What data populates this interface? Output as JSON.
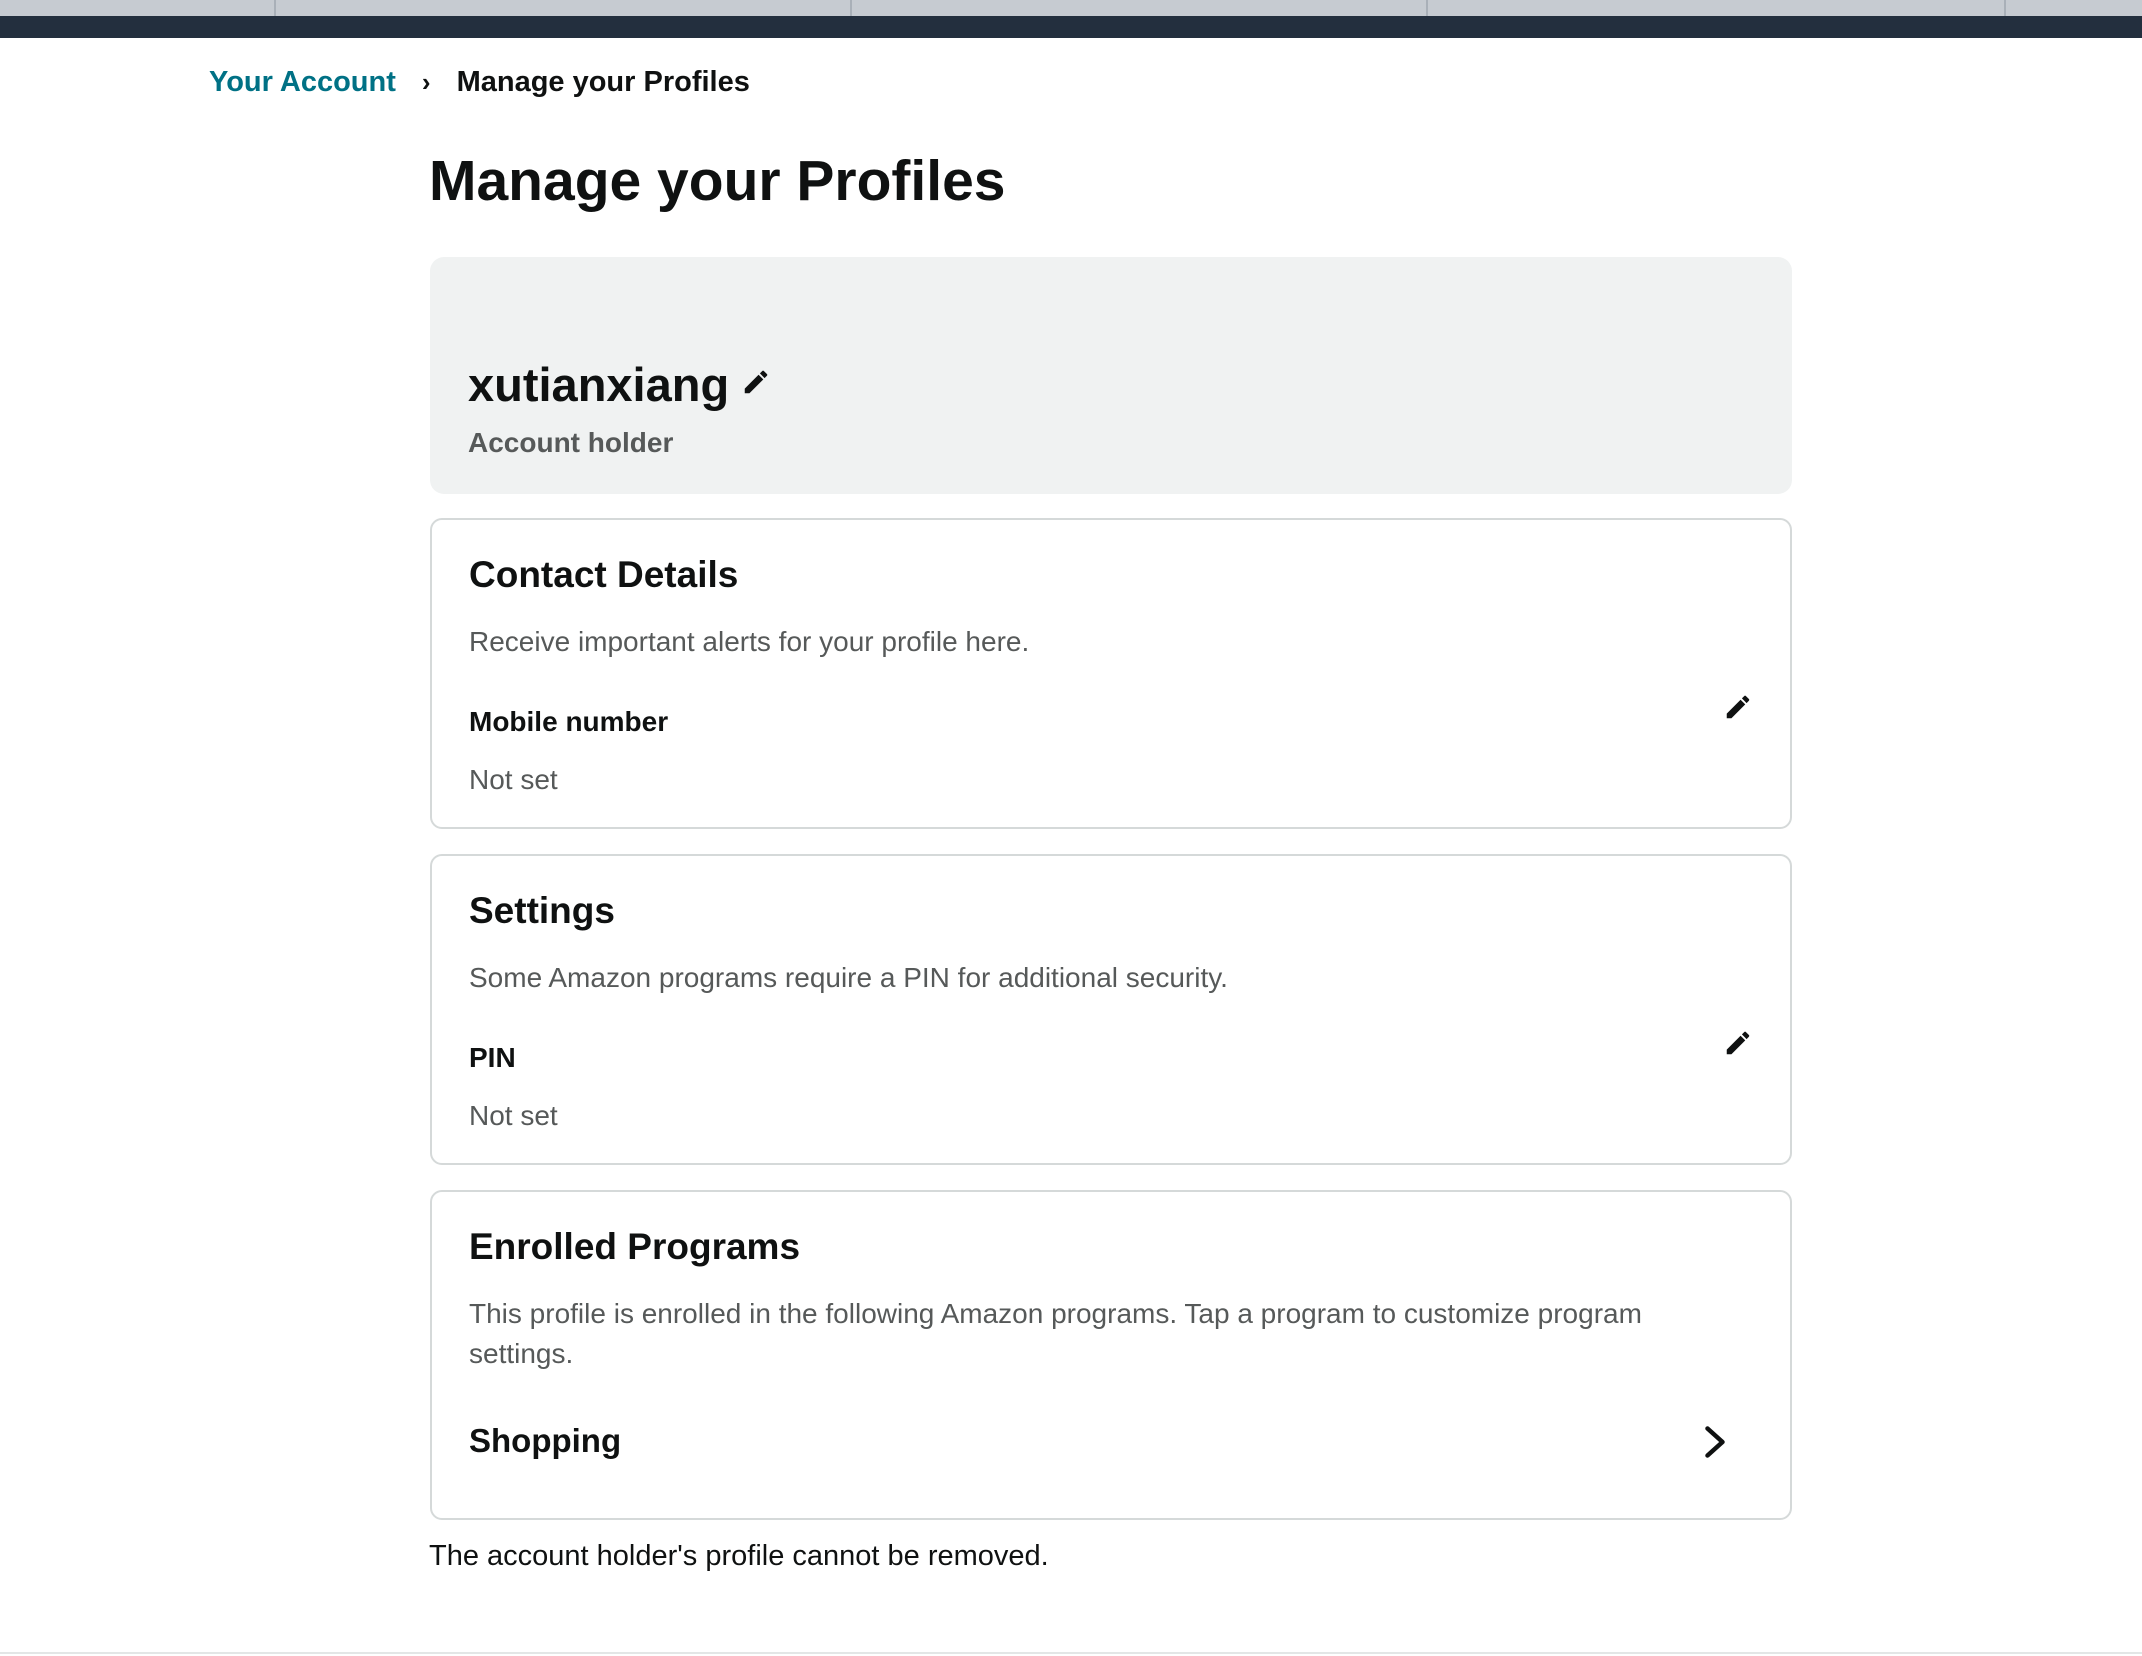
{
  "breadcrumb": {
    "parent": "Your Account",
    "separator": "›",
    "current": "Manage your Profiles"
  },
  "page": {
    "title": "Manage your Profiles"
  },
  "profile": {
    "name": "xutianxiang",
    "role": "Account holder"
  },
  "contact_details": {
    "title": "Contact Details",
    "description": "Receive important alerts for your profile here.",
    "field_label": "Mobile number",
    "field_value": "Not set"
  },
  "settings": {
    "title": "Settings",
    "description": "Some Amazon programs require a PIN for additional security.",
    "field_label": "PIN",
    "field_value": "Not set"
  },
  "enrolled_programs": {
    "title": "Enrolled Programs",
    "description": "This profile is enrolled in the following Amazon programs. Tap a program to customize program settings.",
    "programs": [
      {
        "label": "Shopping"
      }
    ]
  },
  "footer": {
    "note": "The account holder's profile cannot be removed."
  },
  "icons": {
    "edit": "pencil-icon",
    "program_open": "chevron-right-icon"
  },
  "colors": {
    "nav_bar": "#232f3e",
    "link": "#007185",
    "header_card": "#f0f2f2",
    "border": "#d5d9d9",
    "muted_text": "#565959"
  }
}
